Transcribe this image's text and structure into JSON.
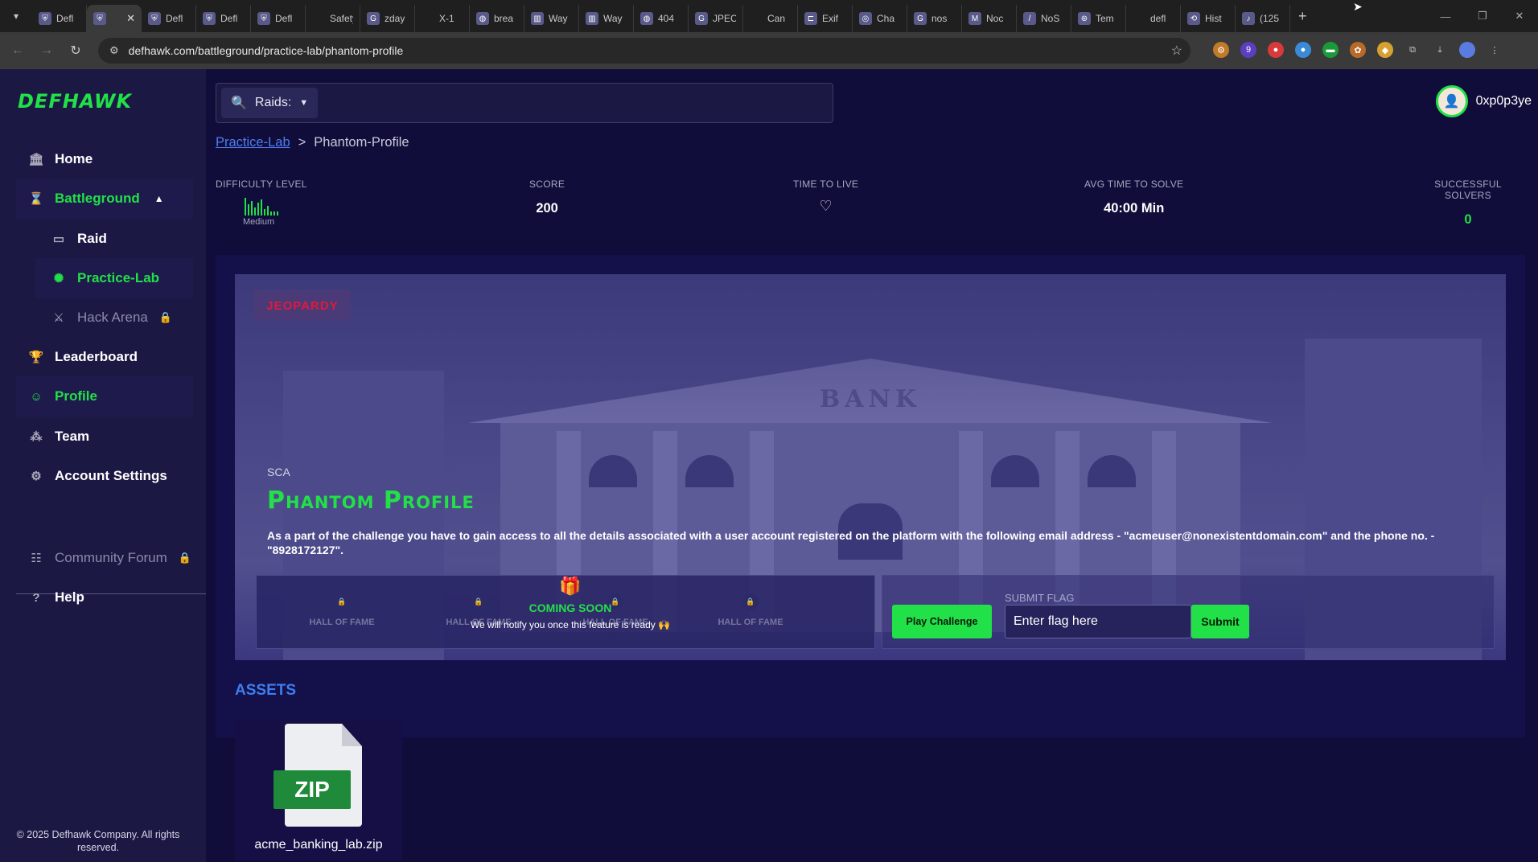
{
  "browser": {
    "tabs": [
      {
        "title": "Defl",
        "icon": "shield-icon",
        "active": false
      },
      {
        "title": "",
        "icon": "shield-icon",
        "active": true
      },
      {
        "title": "Defl",
        "icon": "shield-icon",
        "active": false
      },
      {
        "title": "Defl",
        "icon": "shield-icon",
        "active": false
      },
      {
        "title": "Defl",
        "icon": "shield-icon",
        "active": false
      },
      {
        "title": "Safety w",
        "icon": "",
        "active": false
      },
      {
        "title": "zday",
        "icon": "google-icon",
        "active": false
      },
      {
        "title": "X-1",
        "icon": "",
        "active": false
      },
      {
        "title": "brea",
        "icon": "globe-icon",
        "active": false
      },
      {
        "title": "Way",
        "icon": "archive-icon",
        "active": false
      },
      {
        "title": "Way",
        "icon": "archive-icon",
        "active": false
      },
      {
        "title": "404",
        "icon": "globe-icon",
        "active": false
      },
      {
        "title": "JPEC",
        "icon": "google-icon",
        "active": false
      },
      {
        "title": "Can",
        "icon": "",
        "active": false
      },
      {
        "title": "Exif",
        "icon": "exif-icon",
        "active": false
      },
      {
        "title": "Cha",
        "icon": "chat-icon",
        "active": false
      },
      {
        "title": "nos",
        "icon": "google-icon",
        "active": false
      },
      {
        "title": "Noc",
        "icon": "medium-icon",
        "active": false
      },
      {
        "title": "NoS",
        "icon": "slash-icon",
        "active": false
      },
      {
        "title": "Tem",
        "icon": "temp-icon",
        "active": false
      },
      {
        "title": "defl",
        "icon": "",
        "active": false
      },
      {
        "title": "Hist",
        "icon": "history-icon",
        "active": false
      },
      {
        "title": "(125",
        "icon": "tiktok-icon",
        "active": false
      }
    ],
    "close_glyph": "✕",
    "new_tab_glyph": "+",
    "url": "defhawk.com/battleground/practice-lab/phantom-profile",
    "extension_badge": "9"
  },
  "sidebar": {
    "logo": "DEFHAWK",
    "items": {
      "home": "Home",
      "battleground": "Battleground",
      "raid": "Raid",
      "practice_lab": "Practice-Lab",
      "hack_arena": "Hack Arena",
      "leaderboard": "Leaderboard",
      "profile": "Profile",
      "team": "Team",
      "account_settings": "Account Settings",
      "community_forum": "Community Forum",
      "help": "Help"
    },
    "copyright": "© 2025 Defhawk Company. All rights reserved."
  },
  "header": {
    "search_filter": "Raids:",
    "username": "0xp0p3ye"
  },
  "breadcrumb": {
    "parent": "Practice-Lab",
    "separator": ">",
    "current": "Phantom-Profile"
  },
  "stats": {
    "difficulty_label": "DIFFICULTY LEVEL",
    "difficulty_value": "Medium",
    "score_label": "SCORE",
    "score_value": "200",
    "ttl_label": "TIME TO LIVE",
    "avg_label": "AVG TIME TO SOLVE",
    "avg_value": "40:00 Min",
    "solvers_label": "SUCCESSFUL SOLVERS",
    "solvers_value": "0"
  },
  "challenge": {
    "tag": "JEOPARDY",
    "banner_text": "BANK",
    "category": "SCA",
    "title": "Phantom Profile",
    "description": "As a part of the challenge you have to gain access to all the details associated with a user account registered on the platform with the following email address - \"acmeuser@nonexistentdomain.com\" and the phone no. - \"8928172127\".",
    "hall_of_fame_label": "HALL OF FAME",
    "coming_soon": "COMING SOON",
    "notify_text": "We will notify you once this feature is ready 🙌",
    "play_button": "Play Challenge",
    "submit_flag_label": "SUBMIT FLAG",
    "flag_placeholder": "Enter flag here",
    "submit_button": "Submit"
  },
  "assets": {
    "title": "ASSETS",
    "file_type": "ZIP",
    "file_name": "acme_banking_lab.zip"
  },
  "colors": {
    "accent_green": "#22e048",
    "link_blue": "#4d7df0",
    "danger_red": "#e2183a",
    "bg": "#110d3a"
  }
}
